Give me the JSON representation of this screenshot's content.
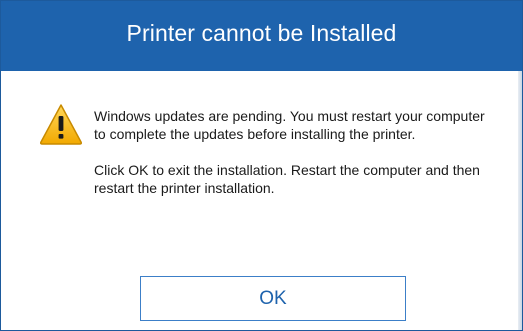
{
  "dialog": {
    "title": "Printer cannot be Installed",
    "icon": "warning-icon",
    "message_line1": " Windows updates are pending. You must restart your computer to complete the updates before installing the printer.",
    "message_line2": "Click OK to exit the installation. Restart the computer and then restart the printer installation.",
    "ok_label": "OK"
  },
  "colors": {
    "titlebar": "#1e63ad",
    "title_text": "#ffffff",
    "button_border": "#3c7fc8",
    "button_text": "#1e63ad",
    "warning_fill": "#f5b400"
  }
}
